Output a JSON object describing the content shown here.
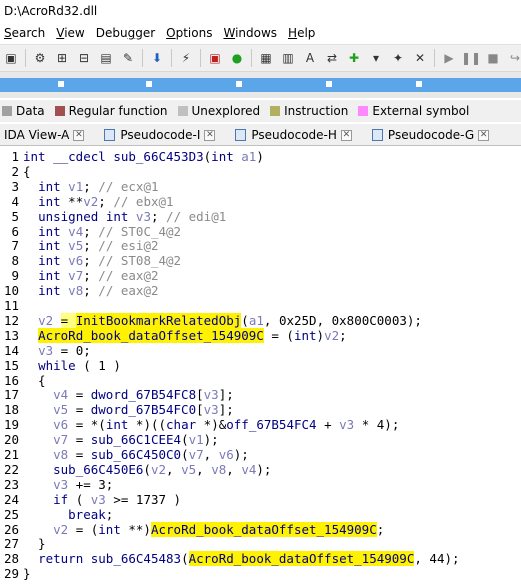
{
  "title": "D:\\AcroRd32.dll",
  "menu": [
    {
      "u": "S",
      "rest": "earch"
    },
    {
      "u": "V",
      "rest": "iew"
    },
    {
      "u": "",
      "pre": "Debu",
      "ul": "g",
      "rest": "ger"
    },
    {
      "u": "O",
      "rest": "ptions"
    },
    {
      "u": "W",
      "rest": "indows"
    },
    {
      "u": "",
      "pre": "",
      "ul": "H",
      "rest": "elp"
    }
  ],
  "legend": [
    {
      "label": "Data",
      "color": "#a0a0a0"
    },
    {
      "label": "Regular function",
      "color": "#a05050"
    },
    {
      "label": "Unexplored",
      "color": "#c0c0c0"
    },
    {
      "label": "Instruction",
      "color": "#b0b060"
    },
    {
      "label": "External symbol",
      "color": "#ff88ff"
    }
  ],
  "tabs": [
    "IDA View-A",
    "Pseudocode-I",
    "Pseudocode-H",
    "Pseudocode-G"
  ],
  "code": [
    {
      "n": "1",
      "html": "<span class=\"k\">int</span> <span class=\"k\">__cdecl</span> <span class=\"f\">sub_66C453D3</span>(<span class=\"k\">int</span> <span class=\"v\">a1</span>)"
    },
    {
      "n": "2",
      "html": "{"
    },
    {
      "n": "3",
      "html": "  <span class=\"k\">int</span> <span class=\"v\">v1</span>; <span class=\"c\">// ecx@1</span>"
    },
    {
      "n": "4",
      "html": "  <span class=\"k\">int</span> **<span class=\"v\">v2</span>; <span class=\"c\">// ebx@1</span>"
    },
    {
      "n": "5",
      "html": "  <span class=\"k\">unsigned</span> <span class=\"k\">int</span> <span class=\"v\">v3</span>; <span class=\"c\">// edi@1</span>"
    },
    {
      "n": "6",
      "html": "  <span class=\"k\">int</span> <span class=\"v\">v4</span>; <span class=\"c\">// ST0C_4@2</span>"
    },
    {
      "n": "7",
      "html": "  <span class=\"k\">int</span> <span class=\"v\">v5</span>; <span class=\"c\">// esi@2</span>"
    },
    {
      "n": "8",
      "html": "  <span class=\"k\">int</span> <span class=\"v\">v6</span>; <span class=\"c\">// ST08_4@2</span>"
    },
    {
      "n": "9",
      "html": "  <span class=\"k\">int</span> <span class=\"v\">v7</span>; <span class=\"c\">// eax@2</span>"
    },
    {
      "n": "10",
      "html": "  <span class=\"k\">int</span> <span class=\"v\">v8</span>; <span class=\"c\">// eax@2</span>"
    },
    {
      "n": "11",
      "html": ""
    },
    {
      "n": "12",
      "html": "  <span class=\"v\">v2</span> <span class=\"hlg\">= </span><span class=\"hl\"><span class=\"f\">InitBookmarkRelatedObj</span></span>(<span class=\"v\">a1</span>, 0x25D, 0x800C0003);"
    },
    {
      "n": "13",
      "html": "  <span class=\"hl\"><span class=\"f\">AcroRd_book_dataOffset_154909C</span></span> = (<span class=\"k\">int</span>)<span class=\"v\">v2</span>;"
    },
    {
      "n": "14",
      "html": "  <span class=\"v\">v3</span> = 0;"
    },
    {
      "n": "15",
      "html": "  <span class=\"k\">while</span> ( 1 )"
    },
    {
      "n": "16",
      "html": "  {"
    },
    {
      "n": "17",
      "html": "    <span class=\"v\">v4</span> = <span class=\"f\">dword_67B54FC8</span>[<span class=\"v\">v3</span>];"
    },
    {
      "n": "18",
      "html": "    <span class=\"v\">v5</span> = <span class=\"f\">dword_67B54FC0</span>[<span class=\"v\">v3</span>];"
    },
    {
      "n": "19",
      "html": "    <span class=\"v\">v6</span> = *(<span class=\"k\">int</span> *)((<span class=\"k\">char</span> *)&amp;<span class=\"f\">off_67B54FC4</span> + <span class=\"v\">v3</span> * 4);"
    },
    {
      "n": "20",
      "html": "    <span class=\"v\">v7</span> = <span class=\"f\">sub_66C1CEE4</span>(<span class=\"v\">v1</span>);"
    },
    {
      "n": "21",
      "html": "    <span class=\"v\">v8</span> = <span class=\"f\">sub_66C450C0</span>(<span class=\"v\">v7</span>, <span class=\"v\">v6</span>);"
    },
    {
      "n": "22",
      "html": "    <span class=\"f\">sub_66C450E6</span>(<span class=\"v\">v2</span>, <span class=\"v\">v5</span>, <span class=\"v\">v8</span>, <span class=\"v\">v4</span>);"
    },
    {
      "n": "23",
      "html": "    <span class=\"v\">v3</span> += 3;"
    },
    {
      "n": "24",
      "html": "    <span class=\"k\">if</span> ( <span class=\"v\">v3</span> &gt;= 1737 )"
    },
    {
      "n": "25",
      "html": "      <span class=\"k\">break</span>;"
    },
    {
      "n": "26",
      "html": "    <span class=\"v\">v2</span> = (<span class=\"k\">int</span> **)<span class=\"hl\"><span class=\"f\">AcroRd_book_dataOffset_154909C</span></span>;"
    },
    {
      "n": "27",
      "html": "  }"
    },
    {
      "n": "28",
      "html": "  <span class=\"k\">return</span> <span class=\"f\">sub_66C45483</span>(<span class=\"hl\"><span class=\"f\">AcroRd_book_dataOffset_154909C</span></span>, 44);"
    },
    {
      "n": "29",
      "html": "}"
    }
  ]
}
